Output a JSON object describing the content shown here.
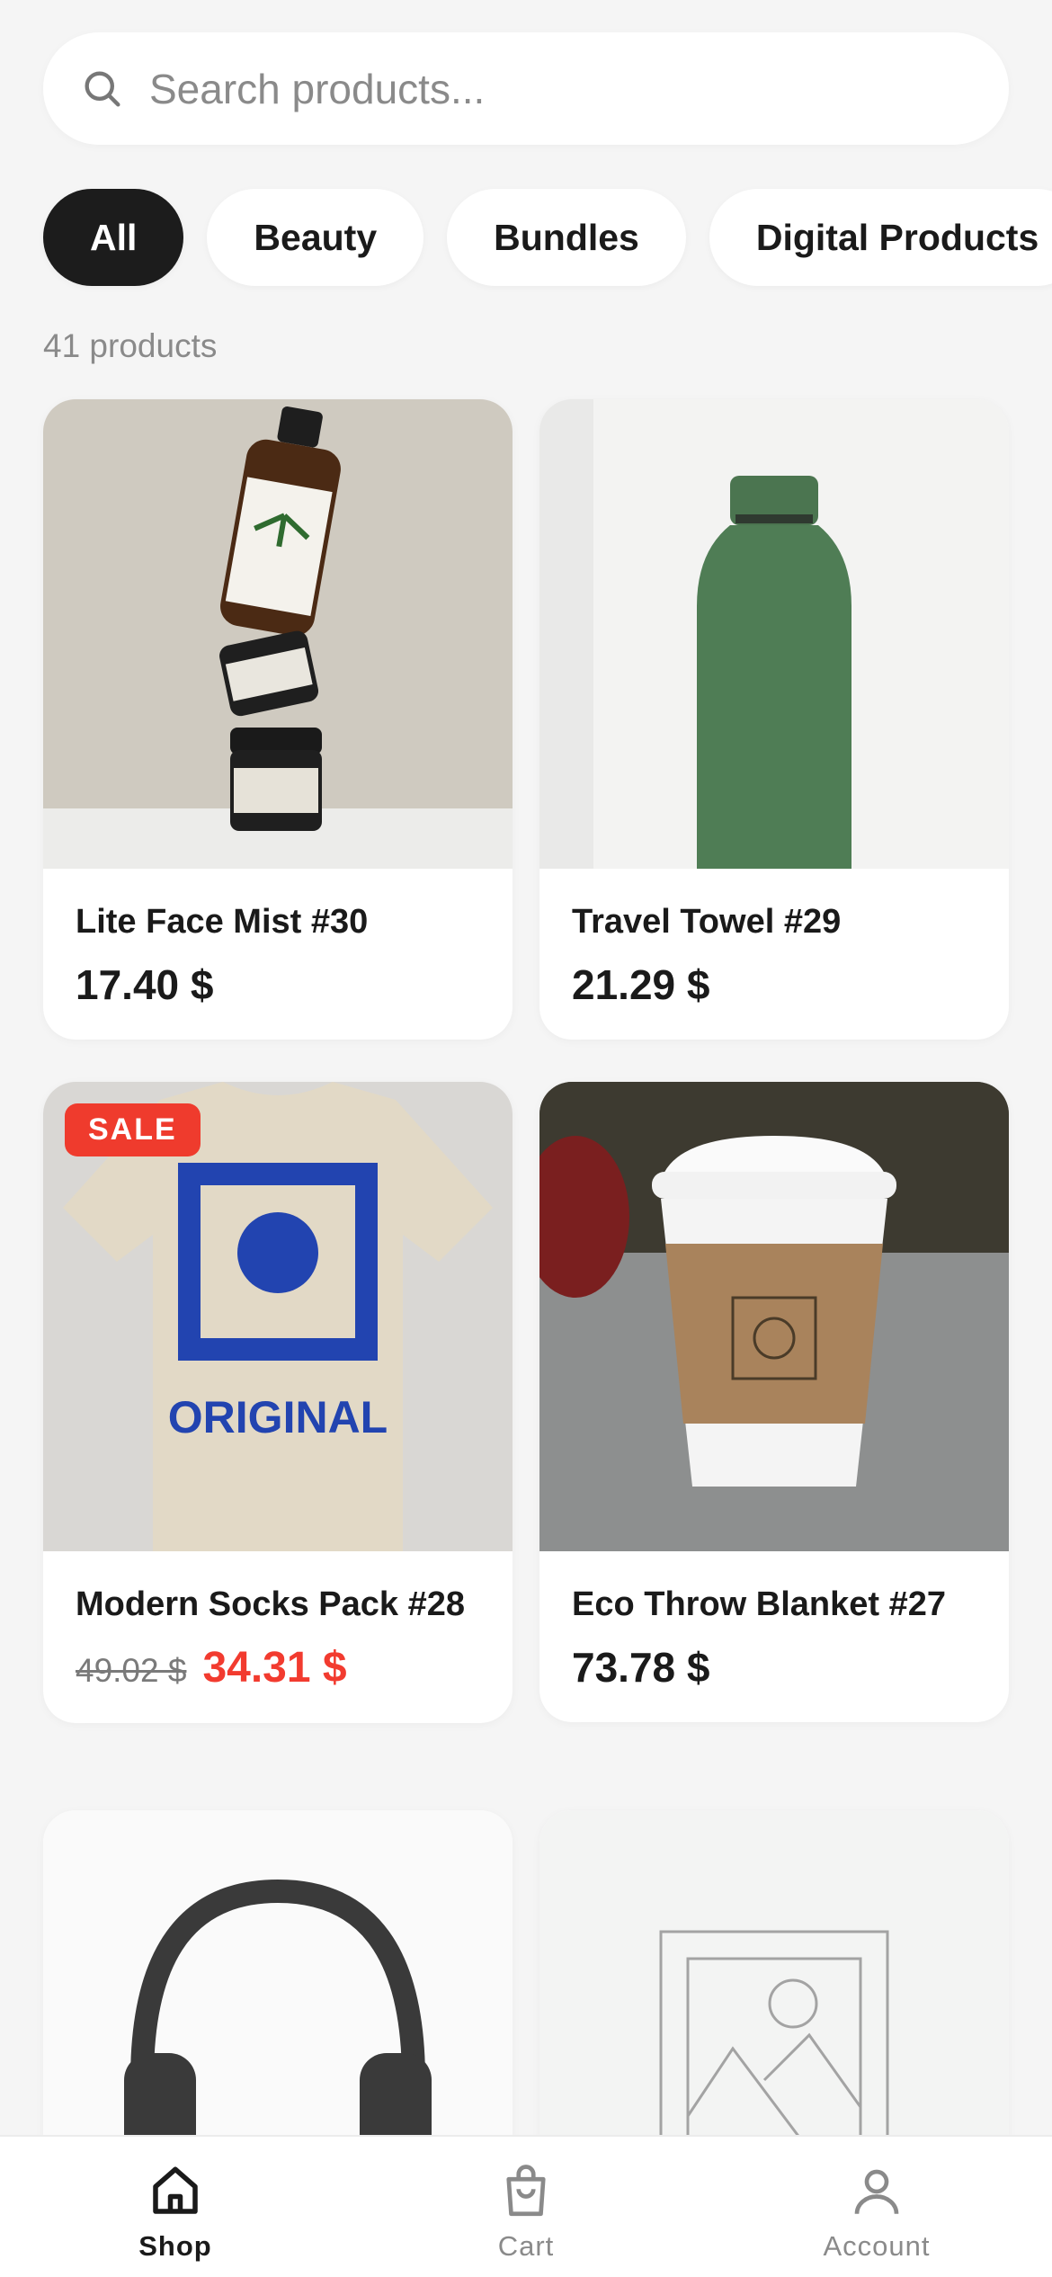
{
  "search": {
    "placeholder": "Search products..."
  },
  "categories": [
    {
      "label": "All",
      "active": true
    },
    {
      "label": "Beauty",
      "active": false
    },
    {
      "label": "Bundles",
      "active": false
    },
    {
      "label": "Digital Products",
      "active": false
    }
  ],
  "product_count_text": "41 products",
  "products": [
    {
      "name": "Lite Face Mist #30",
      "price": "17.40 $",
      "image": "stacked-skincare-jars"
    },
    {
      "name": "Travel Towel #29",
      "price": "21.29 $",
      "image": "green-bottle"
    },
    {
      "name": "Modern Socks Pack #28",
      "badge": "SALE",
      "old_price": "49.02 $",
      "sale_price": "34.31 $",
      "image": "printed-tshirt"
    },
    {
      "name": "Eco Throw Blanket #27",
      "price": "73.78 $",
      "image": "coffee-cup"
    },
    {
      "name": "",
      "image": "headphones"
    },
    {
      "name": "",
      "image": "image-placeholder"
    }
  ],
  "nav": [
    {
      "label": "Shop",
      "icon": "home-icon",
      "active": true
    },
    {
      "label": "Cart",
      "icon": "bag-icon",
      "active": false
    },
    {
      "label": "Account",
      "icon": "user-icon",
      "active": false
    }
  ],
  "colors": {
    "accent": "#1c1c1c",
    "sale": "#ef3b2d",
    "background": "#f5f5f5"
  }
}
